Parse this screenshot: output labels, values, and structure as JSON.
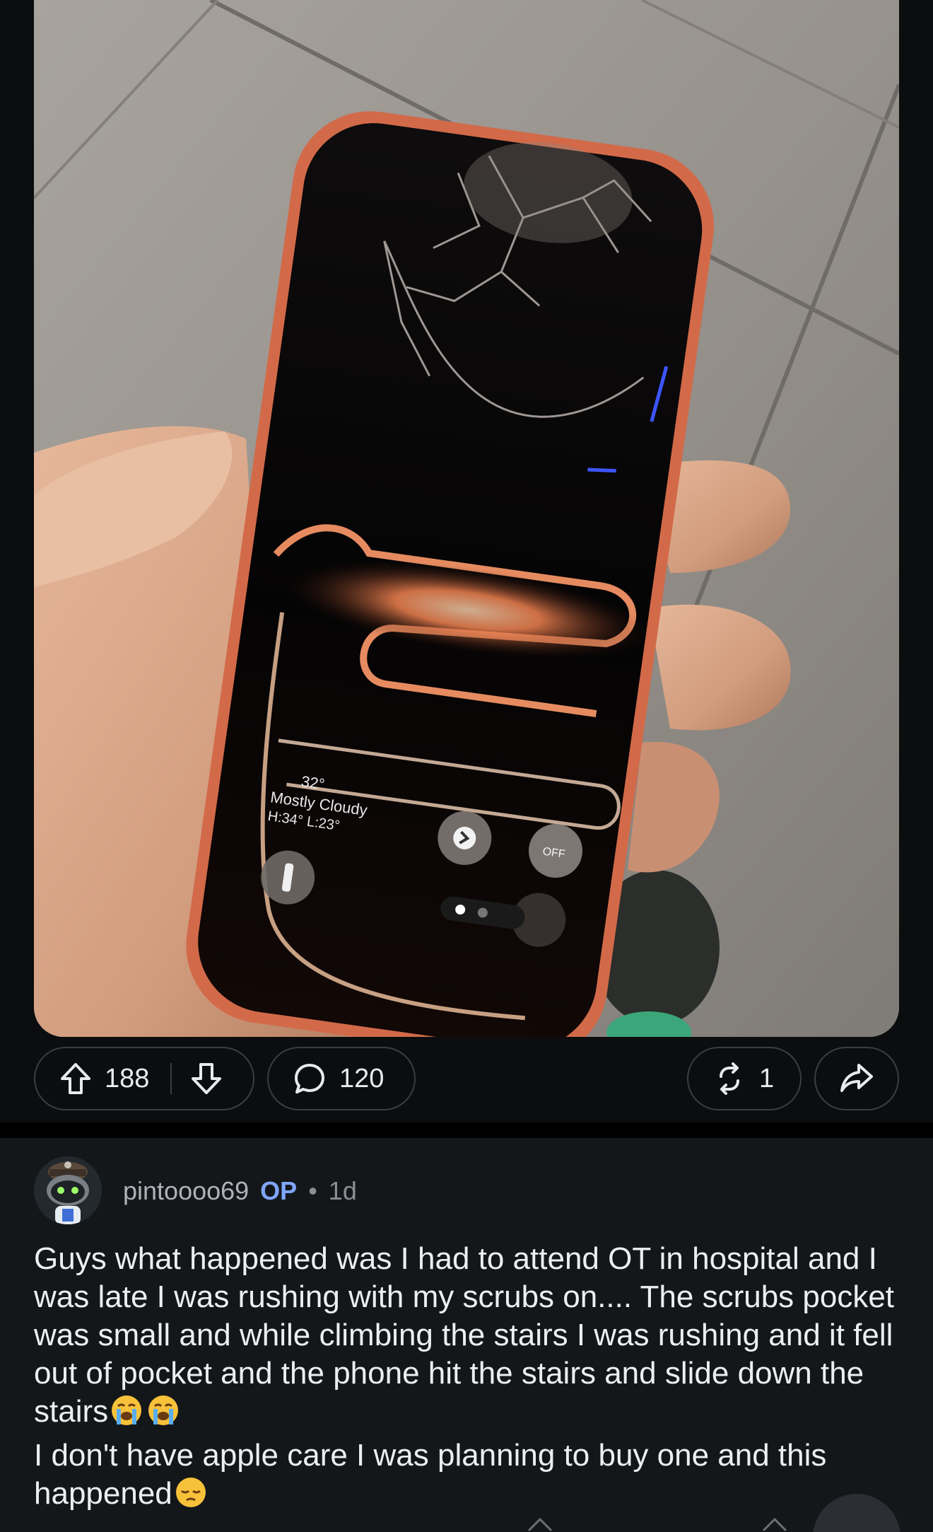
{
  "post": {
    "image": {
      "alt_icons": [
        "cracked-phone-photo"
      ],
      "lockscreen": {
        "temperature": "32°",
        "condition": "Mostly Cloudy",
        "high_low": "H:34° L:23°",
        "focus_off": "OFF"
      }
    },
    "actions": {
      "upvotes": "188",
      "comments": "120",
      "reposts": "1"
    }
  },
  "comment": {
    "username": "pintoooo69",
    "op_badge": "OP",
    "separator": "•",
    "age": "1d",
    "body_line1": "Guys what happened was I had to attend OT in hospital and I was late I was rushing with my scrubs on.... The scrubs pocket was small and while climbing the stairs I was rushing and it fell out of pocket and the phone hit the stairs and slide down the stairs",
    "body_line2": "I don't have apple care I was planning to buy one and this happened"
  },
  "colors": {
    "background": "#0b0d0e",
    "comment_bg": "#14171a",
    "op_blue": "#7fa6ff",
    "pill_border": "#3a3e42"
  }
}
